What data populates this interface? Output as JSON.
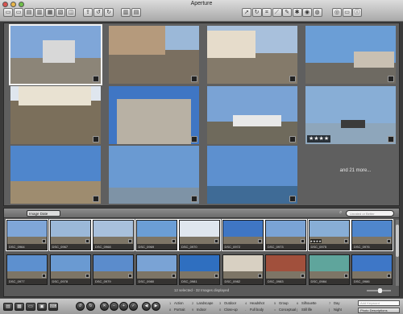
{
  "window": {
    "title": "Aperture"
  },
  "toolbar": {
    "left_buttons": [
      {
        "name": "new-project-button",
        "icon": "folder-icon"
      },
      {
        "name": "new-folder-button",
        "icon": "folder-icon"
      },
      {
        "name": "new-album-button",
        "icon": "album-icon"
      },
      {
        "name": "new-smart-album-button",
        "icon": "smart-album-icon"
      },
      {
        "name": "new-light-table-button",
        "icon": "light-table-icon"
      },
      {
        "name": "new-book-button",
        "icon": "book-icon"
      },
      {
        "name": "new-web-gallery-button",
        "icon": "web-icon"
      },
      {
        "name": "import-button",
        "icon": "import-icon"
      },
      {
        "name": "rotate-left-button",
        "icon": "rotate-left-icon"
      },
      {
        "name": "rotate-right-button",
        "icon": "rotate-right-icon"
      },
      {
        "name": "stack-button",
        "icon": "stack-icon"
      },
      {
        "name": "unstack-button",
        "icon": "unstack-icon"
      }
    ],
    "right_buttons": [
      {
        "name": "select-tool-button",
        "icon": "pointer-icon"
      },
      {
        "name": "rotate-tool-button",
        "icon": "rotate-icon"
      },
      {
        "name": "crop-tool-button",
        "icon": "crop-icon"
      },
      {
        "name": "straighten-tool-button",
        "icon": "straighten-icon"
      },
      {
        "name": "lift-tool-button",
        "icon": "lift-icon"
      },
      {
        "name": "stamp-tool-button",
        "icon": "stamp-icon"
      },
      {
        "name": "redeye-tool-button",
        "icon": "redeye-icon"
      },
      {
        "name": "spot-patch-tool-button",
        "icon": "patch-icon"
      },
      {
        "name": "loupe-button",
        "icon": "loupe-icon"
      },
      {
        "name": "viewer-mode-button",
        "icon": "viewer-icon"
      },
      {
        "name": "inspector-button",
        "icon": "inspector-icon"
      }
    ]
  },
  "viewer": {
    "more_text": "and 21 more..."
  },
  "browser": {
    "sort_label": "Image Date",
    "search_placeholder": "Unrated or Better",
    "status": "12 selected - 32 Images displayed",
    "row1": [
      {
        "name": "DSC_0964"
      },
      {
        "name": "DSC_0967"
      },
      {
        "name": "DSC_0968"
      },
      {
        "name": "DSC_0969"
      },
      {
        "name": "DSC_0970"
      },
      {
        "name": "DSC_0972"
      },
      {
        "name": "DSC_0973"
      },
      {
        "name": "DSC_0975",
        "stars": "★★★★"
      },
      {
        "name": "DSC_0976"
      }
    ],
    "row2": [
      {
        "name": "DSC_0977"
      },
      {
        "name": "DSC_0978"
      },
      {
        "name": "DSC_0979"
      },
      {
        "name": "DSC_0980"
      },
      {
        "name": "DSC_0981"
      },
      {
        "name": "DSC_0982"
      },
      {
        "name": "DSC_0983"
      },
      {
        "name": "DSC_0984"
      },
      {
        "name": "DSC_0986"
      }
    ]
  },
  "stars_label": "★★★★",
  "bottombar": {
    "keywords_row1": [
      "Action",
      "Landscape",
      "Outdoor",
      "Headshot",
      "Group",
      "Silhouette",
      "Day"
    ],
    "keywords_row2": [
      "Portrait",
      "Indoor",
      "Close-up",
      "Full body",
      "Conceptual",
      "Still life",
      "Night"
    ],
    "numbers_row1": [
      "1",
      "2",
      "3",
      "4",
      "5",
      "6",
      "7"
    ],
    "numbers_row2": [
      "8",
      "9",
      "0",
      "-",
      "=",
      "[",
      "]"
    ],
    "keyword_input_placeholder": "Add Keyword",
    "preset_menu": "Photo Descriptions"
  }
}
